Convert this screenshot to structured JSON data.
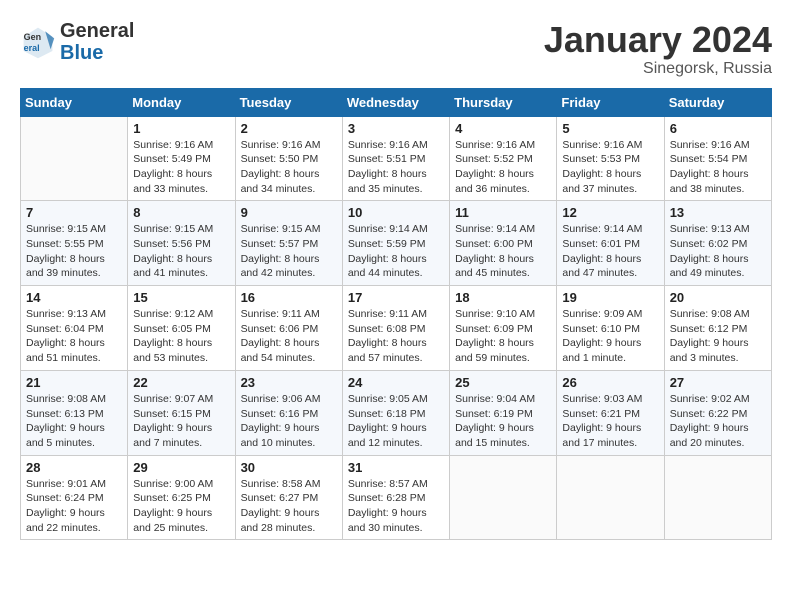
{
  "header": {
    "logo_general": "General",
    "logo_blue": "Blue",
    "month_title": "January 2024",
    "location": "Sinegorsk, Russia"
  },
  "days_of_week": [
    "Sunday",
    "Monday",
    "Tuesday",
    "Wednesday",
    "Thursday",
    "Friday",
    "Saturday"
  ],
  "weeks": [
    [
      {
        "day": "",
        "info": ""
      },
      {
        "day": "1",
        "info": "Sunrise: 9:16 AM\nSunset: 5:49 PM\nDaylight: 8 hours\nand 33 minutes."
      },
      {
        "day": "2",
        "info": "Sunrise: 9:16 AM\nSunset: 5:50 PM\nDaylight: 8 hours\nand 34 minutes."
      },
      {
        "day": "3",
        "info": "Sunrise: 9:16 AM\nSunset: 5:51 PM\nDaylight: 8 hours\nand 35 minutes."
      },
      {
        "day": "4",
        "info": "Sunrise: 9:16 AM\nSunset: 5:52 PM\nDaylight: 8 hours\nand 36 minutes."
      },
      {
        "day": "5",
        "info": "Sunrise: 9:16 AM\nSunset: 5:53 PM\nDaylight: 8 hours\nand 37 minutes."
      },
      {
        "day": "6",
        "info": "Sunrise: 9:16 AM\nSunset: 5:54 PM\nDaylight: 8 hours\nand 38 minutes."
      }
    ],
    [
      {
        "day": "7",
        "info": "Sunrise: 9:15 AM\nSunset: 5:55 PM\nDaylight: 8 hours\nand 39 minutes."
      },
      {
        "day": "8",
        "info": "Sunrise: 9:15 AM\nSunset: 5:56 PM\nDaylight: 8 hours\nand 41 minutes."
      },
      {
        "day": "9",
        "info": "Sunrise: 9:15 AM\nSunset: 5:57 PM\nDaylight: 8 hours\nand 42 minutes."
      },
      {
        "day": "10",
        "info": "Sunrise: 9:14 AM\nSunset: 5:59 PM\nDaylight: 8 hours\nand 44 minutes."
      },
      {
        "day": "11",
        "info": "Sunrise: 9:14 AM\nSunset: 6:00 PM\nDaylight: 8 hours\nand 45 minutes."
      },
      {
        "day": "12",
        "info": "Sunrise: 9:14 AM\nSunset: 6:01 PM\nDaylight: 8 hours\nand 47 minutes."
      },
      {
        "day": "13",
        "info": "Sunrise: 9:13 AM\nSunset: 6:02 PM\nDaylight: 8 hours\nand 49 minutes."
      }
    ],
    [
      {
        "day": "14",
        "info": "Sunrise: 9:13 AM\nSunset: 6:04 PM\nDaylight: 8 hours\nand 51 minutes."
      },
      {
        "day": "15",
        "info": "Sunrise: 9:12 AM\nSunset: 6:05 PM\nDaylight: 8 hours\nand 53 minutes."
      },
      {
        "day": "16",
        "info": "Sunrise: 9:11 AM\nSunset: 6:06 PM\nDaylight: 8 hours\nand 54 minutes."
      },
      {
        "day": "17",
        "info": "Sunrise: 9:11 AM\nSunset: 6:08 PM\nDaylight: 8 hours\nand 57 minutes."
      },
      {
        "day": "18",
        "info": "Sunrise: 9:10 AM\nSunset: 6:09 PM\nDaylight: 8 hours\nand 59 minutes."
      },
      {
        "day": "19",
        "info": "Sunrise: 9:09 AM\nSunset: 6:10 PM\nDaylight: 9 hours\nand 1 minute."
      },
      {
        "day": "20",
        "info": "Sunrise: 9:08 AM\nSunset: 6:12 PM\nDaylight: 9 hours\nand 3 minutes."
      }
    ],
    [
      {
        "day": "21",
        "info": "Sunrise: 9:08 AM\nSunset: 6:13 PM\nDaylight: 9 hours\nand 5 minutes."
      },
      {
        "day": "22",
        "info": "Sunrise: 9:07 AM\nSunset: 6:15 PM\nDaylight: 9 hours\nand 7 minutes."
      },
      {
        "day": "23",
        "info": "Sunrise: 9:06 AM\nSunset: 6:16 PM\nDaylight: 9 hours\nand 10 minutes."
      },
      {
        "day": "24",
        "info": "Sunrise: 9:05 AM\nSunset: 6:18 PM\nDaylight: 9 hours\nand 12 minutes."
      },
      {
        "day": "25",
        "info": "Sunrise: 9:04 AM\nSunset: 6:19 PM\nDaylight: 9 hours\nand 15 minutes."
      },
      {
        "day": "26",
        "info": "Sunrise: 9:03 AM\nSunset: 6:21 PM\nDaylight: 9 hours\nand 17 minutes."
      },
      {
        "day": "27",
        "info": "Sunrise: 9:02 AM\nSunset: 6:22 PM\nDaylight: 9 hours\nand 20 minutes."
      }
    ],
    [
      {
        "day": "28",
        "info": "Sunrise: 9:01 AM\nSunset: 6:24 PM\nDaylight: 9 hours\nand 22 minutes."
      },
      {
        "day": "29",
        "info": "Sunrise: 9:00 AM\nSunset: 6:25 PM\nDaylight: 9 hours\nand 25 minutes."
      },
      {
        "day": "30",
        "info": "Sunrise: 8:58 AM\nSunset: 6:27 PM\nDaylight: 9 hours\nand 28 minutes."
      },
      {
        "day": "31",
        "info": "Sunrise: 8:57 AM\nSunset: 6:28 PM\nDaylight: 9 hours\nand 30 minutes."
      },
      {
        "day": "",
        "info": ""
      },
      {
        "day": "",
        "info": ""
      },
      {
        "day": "",
        "info": ""
      }
    ]
  ]
}
